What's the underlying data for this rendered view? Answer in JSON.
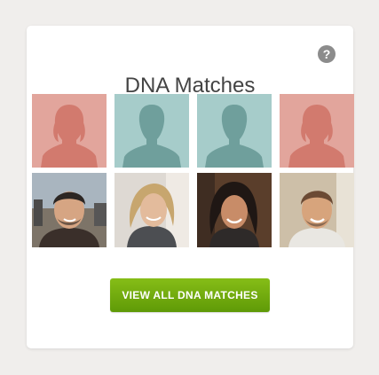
{
  "card": {
    "title": "DNA Matches",
    "help_icon": "question-mark-icon",
    "cta_label": "VIEW ALL DNA MATCHES"
  },
  "colors": {
    "female_bg": "#e2a59c",
    "female_fg": "#d27a6e",
    "male_bg": "#a6ccca",
    "male_fg": "#6f9f9c",
    "button_green": "#72ab0f"
  },
  "matches": {
    "silhouettes": [
      "female-silhouette-icon",
      "male-silhouette-icon",
      "male-silhouette-icon",
      "female-silhouette-icon"
    ],
    "photos": [
      "man-portrait-photo",
      "woman-portrait-photo",
      "woman-portrait-photo",
      "man-portrait-photo"
    ]
  }
}
